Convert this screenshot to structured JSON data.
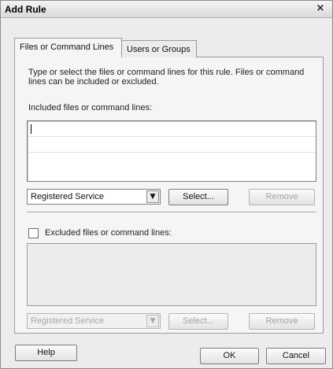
{
  "window": {
    "title": "Add Rule",
    "close_glyph": "×"
  },
  "tabs": [
    {
      "label": "Files or Command Lines",
      "active": true
    },
    {
      "label": "Users or Groups",
      "active": false
    }
  ],
  "files_tab": {
    "description": "Type or select the files or command lines for this rule. Files or command lines can be included or excluded.",
    "included_label": "Included files or command lines:",
    "included_items": [
      "",
      "",
      ""
    ],
    "included_combo_value": "Registered Service",
    "select_label": "Select...",
    "remove_label": "Remove",
    "excluded_checkbox_label": "Excluded files or command lines:",
    "excluded_checked": false,
    "excluded_combo_value": "Registered Service",
    "excluded_select_label": "Select...",
    "excluded_remove_label": "Remove"
  },
  "footer": {
    "help_label": "Help",
    "ok_label": "OK",
    "cancel_label": "Cancel"
  },
  "icons": {
    "combo_arrow": "chevron-down-icon",
    "close": "close-icon"
  }
}
